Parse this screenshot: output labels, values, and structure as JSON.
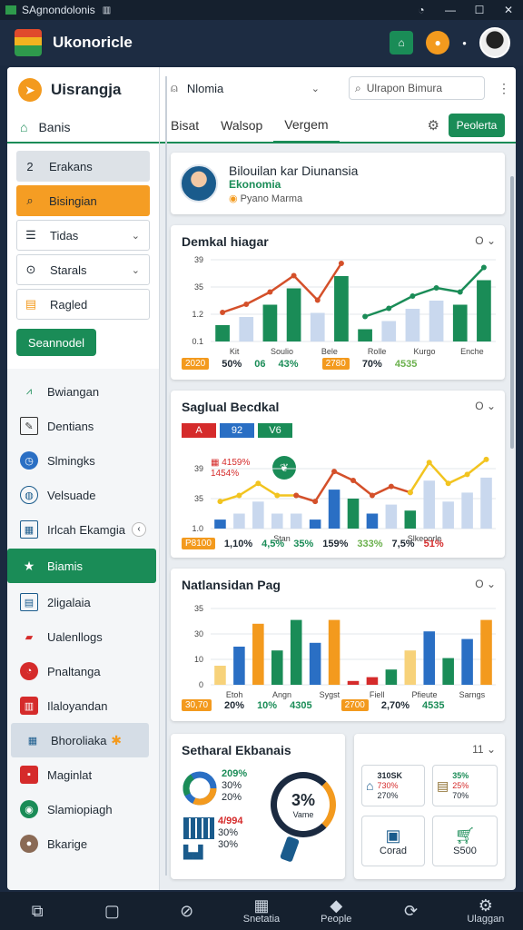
{
  "window": {
    "title": "SAgnondolonis",
    "mini": "▥"
  },
  "app": {
    "title": "Ukonoricle"
  },
  "sidebar": {
    "brand": "Uisrangja",
    "home": "Banis",
    "items": [
      {
        "label": "Erakans",
        "icon": "2"
      },
      {
        "label": "Bisingian",
        "icon": "search-icon"
      },
      {
        "label": "Tidas",
        "icon": "list-icon"
      },
      {
        "label": "Starals",
        "icon": "pin-icon"
      },
      {
        "label": "Ragled",
        "icon": "note-icon"
      }
    ],
    "button": "Seannodel",
    "list": [
      {
        "label": "Bwiangan",
        "icon": "chart-icon"
      },
      {
        "label": "Dentians",
        "icon": "edit-icon"
      },
      {
        "label": "Slmingks",
        "icon": "clock-icon"
      },
      {
        "label": "Velsuade",
        "icon": "globe-icon"
      },
      {
        "label": "Irlcah Ekamgia",
        "icon": "calendar-icon",
        "badge": "‹"
      },
      {
        "label": "Biamis",
        "icon": "star-icon"
      },
      {
        "label": "2ligalaia",
        "icon": "doc-icon"
      },
      {
        "label": "Ualenllogs",
        "icon": "flag-icon"
      },
      {
        "label": "Pnaltanga",
        "icon": "pie-icon"
      },
      {
        "label": "Ilaloyandan",
        "icon": "stack-icon"
      },
      {
        "label": "Bhoroliaka",
        "icon": "grid-icon"
      },
      {
        "label": "Maginlat",
        "icon": "box-icon"
      },
      {
        "label": "Slamiopiagh",
        "icon": "target-icon"
      },
      {
        "label": "Bkarige",
        "icon": "user-icon"
      }
    ]
  },
  "toolbar": {
    "select": "Nlomia",
    "search": "Ulrapon Bimura"
  },
  "tabs": [
    "Bisat",
    "Walsop",
    "Vergem"
  ],
  "tab_button": "Peolerta",
  "profile": {
    "name": "Bilouilan kar Diunansia",
    "sub": "Ekonomia",
    "meta": "Pyano Marma"
  },
  "cards": {
    "c1": {
      "title": "Demkal hiagar",
      "opt": "O",
      "ylabels": [
        "39",
        "35",
        "1.2",
        "0.1"
      ],
      "xlabels": [
        "Kit",
        "Soulio",
        "Bele",
        "Rolle",
        "Kurgo",
        "Enche"
      ],
      "stats": [
        "2020",
        "50%",
        "06",
        "43%",
        "2780",
        "70%",
        "4535"
      ]
    },
    "c2": {
      "title": "Saglual Becdkal",
      "opt": "O",
      "legend": [
        "A",
        "92",
        "V6"
      ],
      "notes": [
        "4159%",
        "1454%"
      ],
      "ylabels": [
        "39",
        "35",
        "1.0"
      ],
      "xlabels": [
        "Stan",
        "Slkeoorle"
      ],
      "stats": [
        "P8100",
        "1,10%",
        "4,5%",
        "35%",
        "159%",
        "333%",
        "7,5%",
        "51%"
      ]
    },
    "c3": {
      "title": "Natlansidan Pag",
      "opt": "O",
      "ylabels": [
        "35",
        "30",
        "10",
        "0"
      ],
      "xlabels": [
        "Etoh",
        "Angn",
        "Sygst",
        "Fiell",
        "Pfieute",
        "Sarngs"
      ],
      "stats": [
        "30,70",
        "20%",
        "10%",
        "4305",
        "2700",
        "2,70%",
        "4535"
      ]
    },
    "c4": {
      "title": "Setharal Ekbanais",
      "donut_stats": [
        "209%",
        "30%",
        "20%"
      ],
      "gauge": "3%",
      "gauge_label": "Vame",
      "table_stats": [
        "4/994",
        "30%",
        "30%"
      ]
    },
    "c5": {
      "opt": "11",
      "tiles": [
        {
          "t": "310SK",
          "s1": "730%",
          "s2": "270%"
        },
        {
          "t": "35%",
          "s1": "25%",
          "s2": "70%"
        },
        {
          "t": "Corad"
        },
        {
          "t": "S500"
        }
      ]
    }
  },
  "chart_data": [
    {
      "type": "bar",
      "title": "Demkal hiagar",
      "series": [
        {
          "values": [
            4,
            6,
            9,
            13,
            7,
            16,
            3,
            5,
            8,
            10,
            9,
            15
          ]
        }
      ],
      "ylim": [
        0,
        20
      ]
    },
    {
      "type": "bar",
      "title": "Saglual Becdkal",
      "series": [
        {
          "values": [
            3,
            5,
            9,
            5,
            5,
            3,
            13,
            10,
            5,
            8,
            6,
            16,
            9,
            12,
            17
          ]
        }
      ],
      "ylim": [
        0,
        20
      ]
    },
    {
      "type": "bar",
      "title": "Natlansidan Pag",
      "series": [
        {
          "values": [
            5,
            10,
            16,
            9,
            17,
            11,
            17,
            1,
            2,
            4,
            9,
            14,
            7,
            12,
            17
          ]
        }
      ],
      "ylim": [
        0,
        20
      ]
    }
  ],
  "taskbar": [
    "",
    "",
    "",
    "Snetatia",
    "People",
    "",
    "Ulaggan"
  ]
}
